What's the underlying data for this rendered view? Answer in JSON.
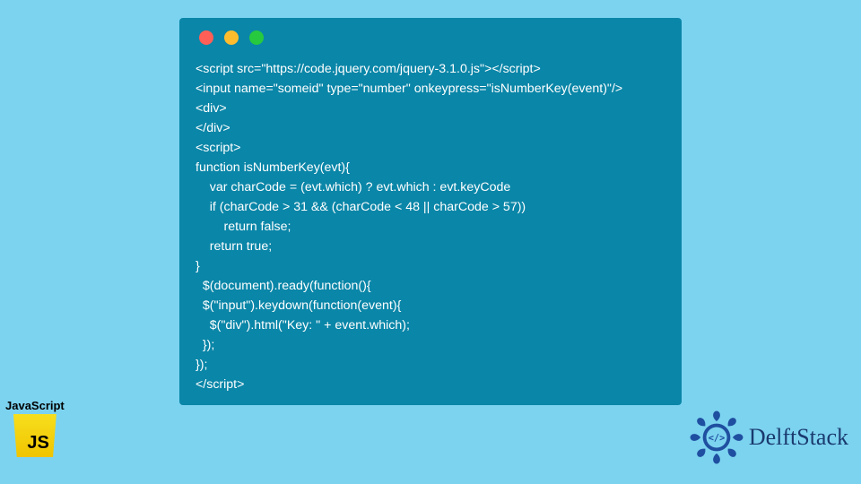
{
  "code_window": {
    "lines": [
      "<script src=\"https://code.jquery.com/jquery-3.1.0.js\"></script>",
      "<input name=\"someid\" type=\"number\" onkeypress=\"isNumberKey(event)\"/>",
      "<div>",
      "</div>",
      "<script>",
      "function isNumberKey(evt){",
      "    var charCode = (evt.which) ? evt.which : evt.keyCode",
      "    if (charCode > 31 && (charCode < 48 || charCode > 57))",
      "        return false;",
      "    return true;",
      "}",
      "  $(document).ready(function(){",
      "  $(\"input\").keydown(function(event){",
      "    $(\"div\").html(\"Key: \" + event.which);",
      "  });",
      "});",
      "</script>"
    ]
  },
  "js_badge": {
    "label": "JavaScript",
    "logo_text": "JS"
  },
  "brand": {
    "name": "DelftStack"
  }
}
